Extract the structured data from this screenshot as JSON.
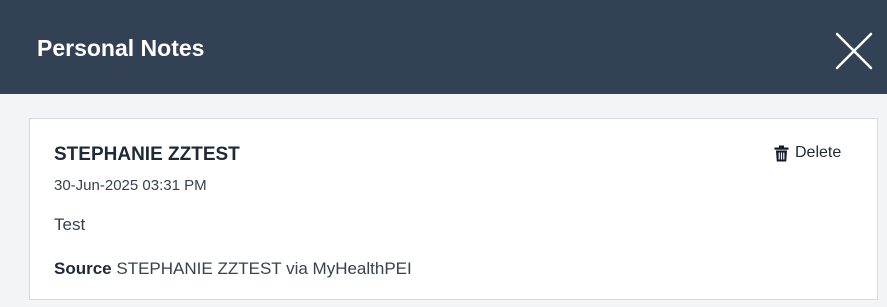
{
  "modal": {
    "title": "Personal Notes",
    "close_icon": "close-icon"
  },
  "note": {
    "author": "STEPHANIE ZZTEST",
    "timestamp": "30-Jun-2025 03:31 PM",
    "text": "Test",
    "source_label": "Source",
    "source_value": "STEPHANIE ZZTEST via MyHealthPEI",
    "delete_label": "Delete",
    "delete_icon": "trash-icon"
  },
  "colors": {
    "header_bg": "#334155",
    "page_bg": "#f3f4f6",
    "card_bg": "#ffffff"
  }
}
